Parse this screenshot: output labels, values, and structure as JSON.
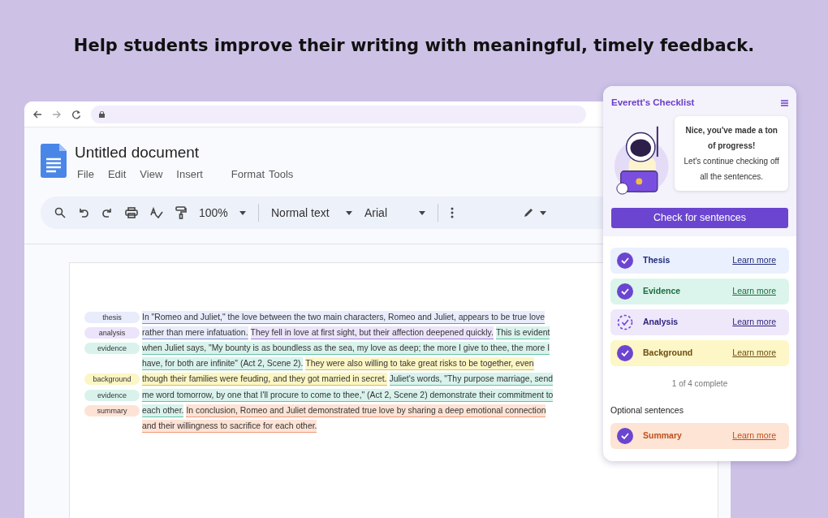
{
  "headline": "Help students improve their writing with meaningful, timely feedback.",
  "document": {
    "title": "Untitled document",
    "menu": [
      "File",
      "Edit",
      "View",
      "Insert",
      "Format",
      "Tools"
    ],
    "toolbar": {
      "zoom": "100%",
      "style": "Normal text",
      "font": "Arial"
    },
    "lines": [
      {
        "tag": {
          "label": "thesis",
          "kind": "thesis"
        },
        "segments": [
          {
            "text": "In \"Romeo and Juliet,\" the love between the two main characters, Romeo and Juliet, appears to be true love",
            "kind": "thesis"
          }
        ]
      },
      {
        "tag": {
          "label": "analysis",
          "kind": "analysis"
        },
        "segments": [
          {
            "text": "rather than mere infatuation.",
            "kind": "thesis"
          },
          {
            "text": "They fell in love at first sight, but their affection deepened quickly.",
            "kind": "analysis"
          },
          {
            "text": "This is evident",
            "kind": "evidence"
          }
        ]
      },
      {
        "tag": {
          "label": "evidence",
          "kind": "evidence"
        },
        "segments": [
          {
            "text": "when Juliet says, \"My bounty is as boundless as the sea, my love as deep; the more I give to thee, the more I",
            "kind": "evidence"
          }
        ]
      },
      {
        "segments": [
          {
            "text": "have, for both are infinite\" (Act 2, Scene 2).",
            "kind": "evidence"
          },
          {
            "text": "They were also willing to take great risks to be together, even",
            "kind": "background"
          }
        ]
      },
      {
        "tag": {
          "label": "background",
          "kind": "background"
        },
        "segments": [
          {
            "text": "though their families were feuding, and they got married in secret.",
            "kind": "background"
          },
          {
            "text": "Juliet's words, \"Thy purpose marriage, send",
            "kind": "evidence"
          }
        ]
      },
      {
        "tag": {
          "label": "evidence",
          "kind": "evidence"
        },
        "segments": [
          {
            "text": "me word tomorrow, by one that I'll procure to come to thee,\" (Act 2, Scene 2) demonstrate their commitment to",
            "kind": "evidence"
          }
        ]
      },
      {
        "tag": {
          "label": "summary",
          "kind": "summary"
        },
        "segments": [
          {
            "text": "each other.",
            "kind": "evidence"
          },
          {
            "text": "In conclusion, Romeo and Juliet demonstrated true love by sharing a deep emotional connection",
            "kind": "summary"
          }
        ]
      },
      {
        "segments": [
          {
            "text": "and their willingness to sacrifice for each other.",
            "kind": "summary"
          }
        ]
      }
    ]
  },
  "checklist": {
    "title": "Everett's Checklist",
    "message_bold": "Nice, you've made a ton of progress!",
    "message": "Let's continue checking off all the sentences.",
    "button": "Check for sentences",
    "items": [
      {
        "label": "Thesis",
        "kind": "thesis",
        "checked": true,
        "link": "Learn more"
      },
      {
        "label": "Evidence",
        "kind": "evidence",
        "checked": true,
        "link": "Learn more"
      },
      {
        "label": "Analysis",
        "kind": "analysis",
        "checked": false,
        "link": "Learn more"
      },
      {
        "label": "Background",
        "kind": "background",
        "checked": true,
        "link": "Learn more"
      }
    ],
    "progress": "1 of 4 complete",
    "optional_heading": "Optional sentences",
    "optional_items": [
      {
        "label": "Summary",
        "kind": "summary",
        "checked": true,
        "link": "Learn more"
      }
    ]
  }
}
